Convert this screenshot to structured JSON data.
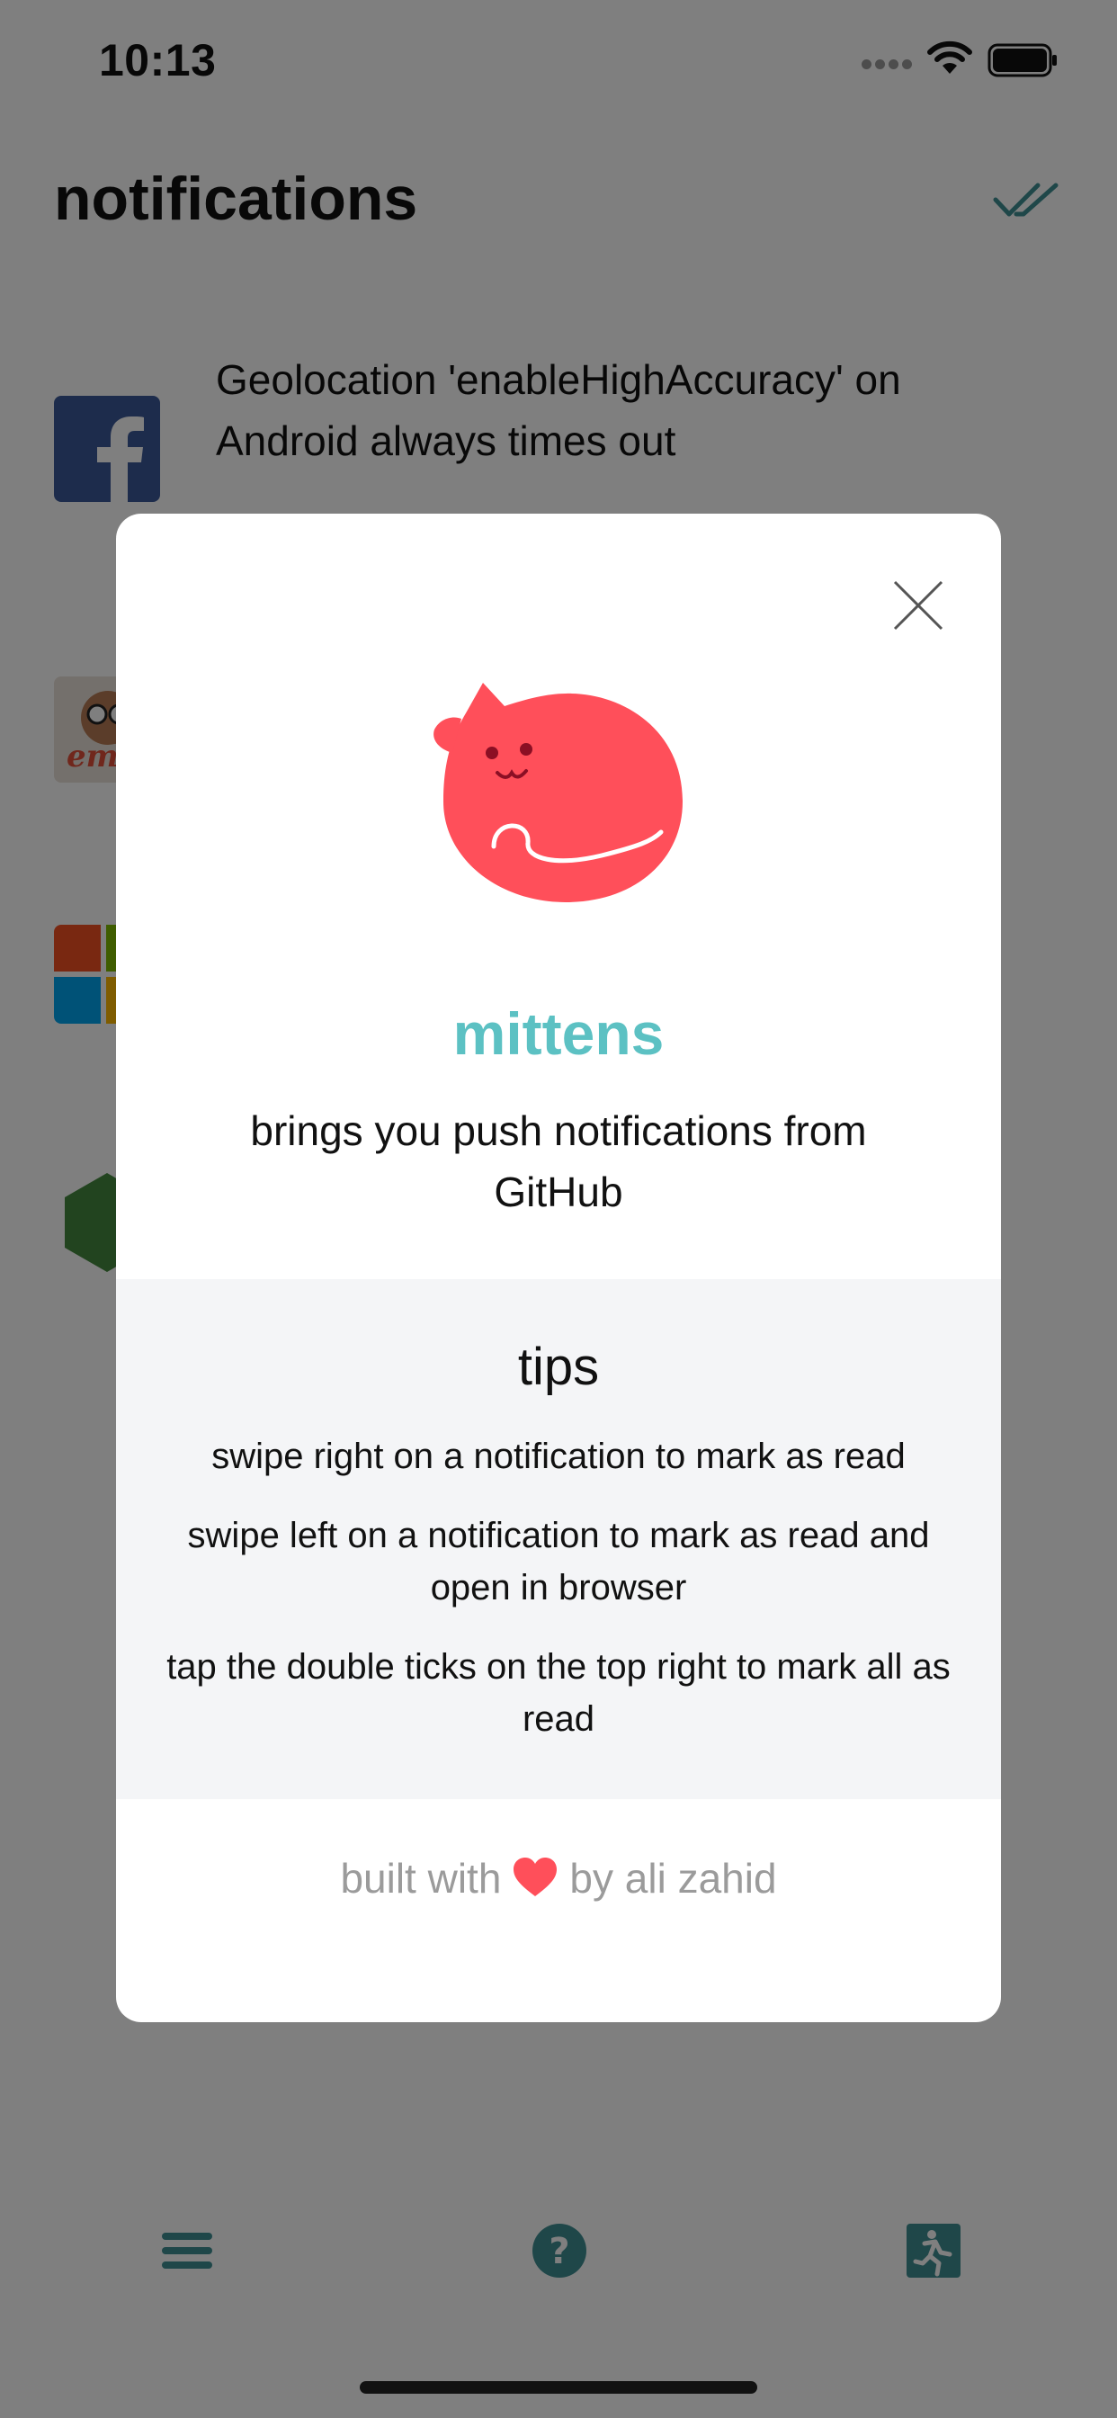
{
  "status_bar": {
    "time": "10:13"
  },
  "header": {
    "title": "notifications",
    "mark_all_icon": "double-tick-icon"
  },
  "notifications": [
    {
      "icon": "facebook-logo",
      "title": "Geolocation 'enableHighAccuracy' on Android always times out"
    },
    {
      "icon": "ember-logo"
    },
    {
      "icon": "microsoft-logo"
    },
    {
      "icon": "nodejs-logo"
    }
  ],
  "modal": {
    "close_icon": "close-icon",
    "app_name": "mittens",
    "tagline": "brings you push notifications from GitHub",
    "tips_title": "tips",
    "tips": [
      "swipe right on a notification to mark as read",
      "swipe left on a notification to mark as read and open in browser",
      "tap the double ticks on the top right to mark all as read"
    ],
    "footer_prefix": "built with",
    "footer_suffix": "by ali zahid"
  },
  "tab_bar": {
    "items": [
      {
        "icon": "menu-icon"
      },
      {
        "icon": "help-icon"
      },
      {
        "icon": "logout-icon"
      }
    ]
  },
  "colors": {
    "accent": "#5cc1c3",
    "tab_icon": "#3f8f93",
    "heart": "#ff4f5a",
    "overlay": "rgba(0,0,0,0.5)",
    "tips_bg": "#f4f5f7"
  }
}
